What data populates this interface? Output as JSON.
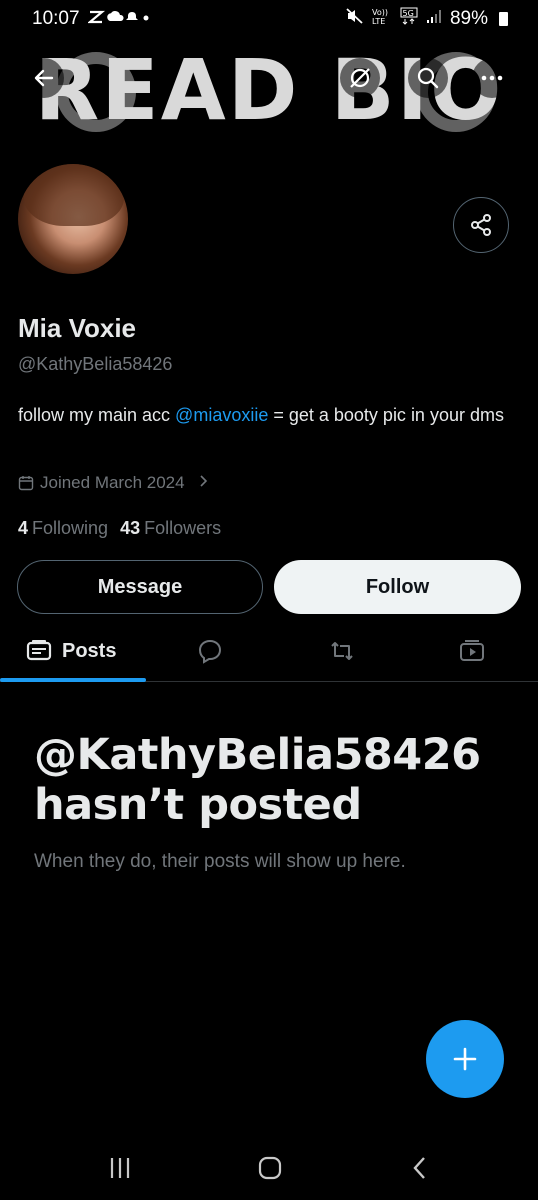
{
  "status_bar": {
    "time": "10:07",
    "battery_pct": "89%",
    "icons": [
      "notification-icons",
      "mute-icon",
      "volte-icon",
      "5g-icon",
      "signal-icon",
      "battery-icon"
    ]
  },
  "banner": {
    "text": "READ BIO"
  },
  "profile": {
    "display_name": "Mia Voxie",
    "handle": "@KathyBelia58426",
    "bio_before": "follow my main acc ",
    "bio_mention": "@miavoxiie",
    "bio_after": " = get a booty pic in your dms",
    "joined": "Joined March 2024",
    "following_count": "4",
    "following_label": "Following",
    "followers_count": "43",
    "followers_label": "Followers"
  },
  "actions": {
    "message_label": "Message",
    "follow_label": "Follow"
  },
  "tabs": {
    "posts_label": "Posts"
  },
  "empty_state": {
    "title": "@KathyBelia58426 hasn’t posted",
    "subtitle": "When they do, their posts will show up here."
  },
  "colors": {
    "accent": "#1d9bf0",
    "background": "#000000",
    "muted": "#71767b"
  }
}
